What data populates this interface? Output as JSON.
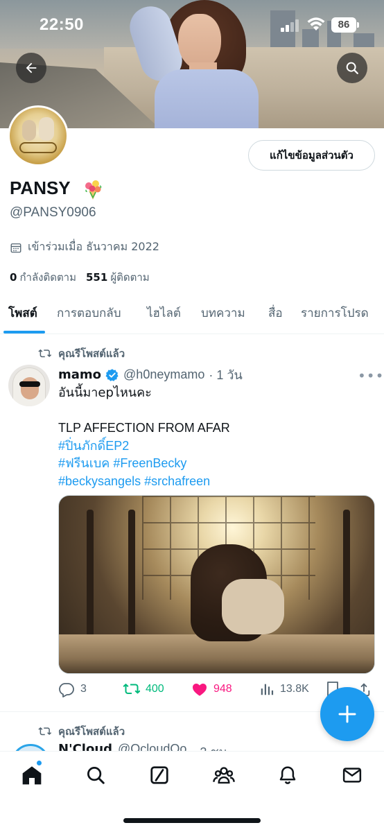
{
  "status_bar": {
    "time": "22:50",
    "battery": "86"
  },
  "profile": {
    "edit_button": "แก้ไขข้อมูลส่วนตัว",
    "display_name": "PANSY",
    "handle": "@PANSY0906",
    "joined": "เข้าร่วมเมื่อ ธันวาคม 2022",
    "following_count": "0",
    "following_label": "กำลังติดตาม",
    "followers_count": "551",
    "followers_label": "ผู้ติดตาม"
  },
  "tabs": [
    "โพสต์",
    "การตอบกลับ",
    "ไฮไลต์",
    "บทความ",
    "สื่อ",
    "รายการโปรด"
  ],
  "tweets": [
    {
      "repost_label": "คุณรีโพสต์แล้ว",
      "name": "mamo",
      "handle": "@h0neymamo",
      "time": "· 1 วัน",
      "text_line1": "อันนี้มาepไหนคะ",
      "text_line3": "TLP AFFECTION FROM AFAR",
      "hashtag_line1": "#ปิ่นภักดิ์EP2",
      "hashtag_line2": "#ฟรีนเบค #FreenBecky",
      "hashtag_line3": "#beckysangels #srchafreen",
      "replies": "3",
      "reposts": "400",
      "likes": "948",
      "views": "13.8K"
    },
    {
      "repost_label": "คุณรีโพสต์แล้ว",
      "name": "N'Cloud",
      "handle": "@OcloudOo",
      "time": "· 2 ชม."
    }
  ],
  "icons": {
    "back": "arrow-left-icon",
    "search": "search-icon",
    "calendar": "calendar-icon",
    "repost": "repost-icon",
    "verified": "verified-badge-icon",
    "reply": "reply-icon",
    "like": "heart-icon",
    "views": "views-icon",
    "bookmark": "bookmark-icon",
    "share": "share-icon",
    "compose": "plus-icon",
    "nav": [
      "home-icon",
      "search-icon",
      "grok-icon",
      "communities-icon",
      "notifications-icon",
      "messages-icon"
    ]
  },
  "colors": {
    "accent": "#1d9bf0",
    "repost_active": "#00ba7c",
    "like_active": "#f91880",
    "secondary_text": "#536471"
  }
}
